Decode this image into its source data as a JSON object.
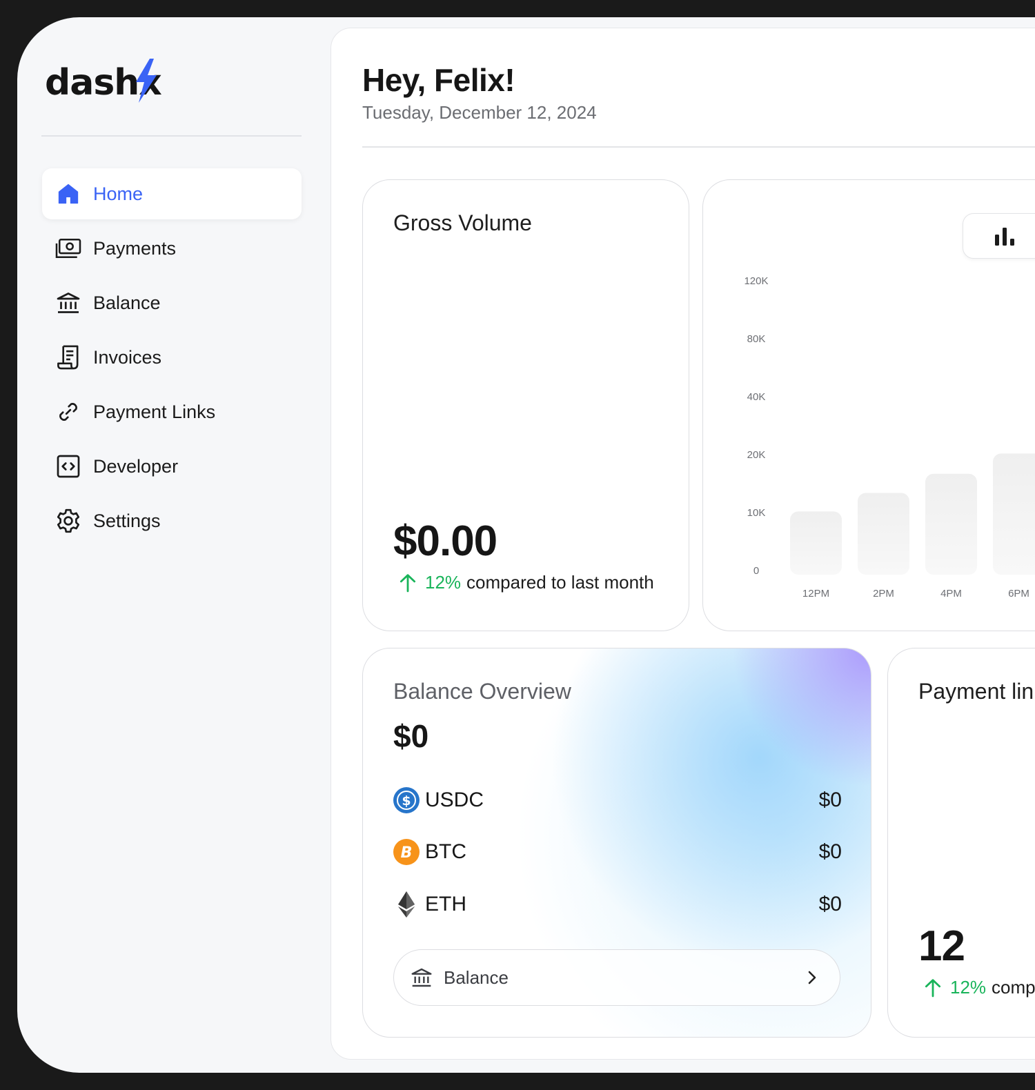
{
  "brand": {
    "name": "dashx",
    "accent": "#3a63f5"
  },
  "sidebar": {
    "items": [
      {
        "label": "Home",
        "icon": "home-icon",
        "active": true
      },
      {
        "label": "Payments",
        "icon": "cash-icon",
        "active": false
      },
      {
        "label": "Balance",
        "icon": "bank-icon",
        "active": false
      },
      {
        "label": "Invoices",
        "icon": "invoice-icon",
        "active": false
      },
      {
        "label": "Payment Links",
        "icon": "link-icon",
        "active": false
      },
      {
        "label": "Developer",
        "icon": "code-icon",
        "active": false
      },
      {
        "label": "Settings",
        "icon": "gear-icon",
        "active": false
      }
    ]
  },
  "header": {
    "greeting": "Hey, Felix!",
    "date": "Tuesday, December 12, 2024"
  },
  "gross_volume": {
    "title": "Gross Volume",
    "amount": "$0.00",
    "change_pct": "12%",
    "change_text": "compared to last month",
    "positive_color": "#19b45a"
  },
  "chart_data": {
    "type": "bar",
    "y_ticks": [
      "120K",
      "80K",
      "40K",
      "20K",
      "10K",
      "0"
    ],
    "categories": [
      "12PM",
      "2PM",
      "4PM",
      "6PM"
    ],
    "values": [
      10200,
      13400,
      16700,
      20400
    ]
  },
  "balance_overview": {
    "title": "Balance Overview",
    "total": "$0",
    "assets": [
      {
        "name": "USDC",
        "value": "$0",
        "icon": "usdc-icon",
        "color": "#2775ca"
      },
      {
        "name": "BTC",
        "value": "$0",
        "icon": "btc-icon",
        "color": "#f7931a"
      },
      {
        "name": "ETH",
        "value": "$0",
        "icon": "eth-icon",
        "color": "#3c3c3d"
      }
    ],
    "button_label": "Balance"
  },
  "payment_links": {
    "title": "Payment links",
    "count": "12",
    "change_pct": "12%",
    "change_text": "compared to last month"
  }
}
